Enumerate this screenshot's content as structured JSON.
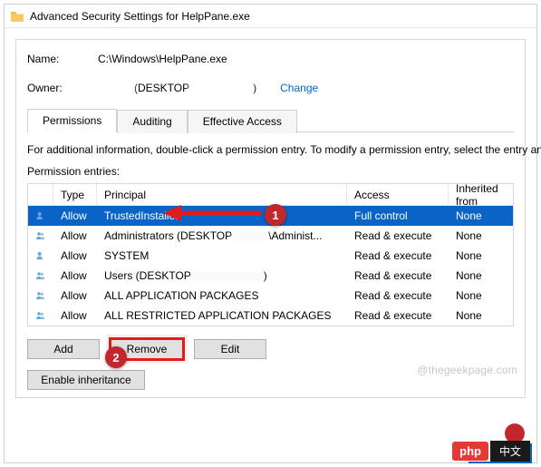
{
  "window": {
    "title": "Advanced Security Settings for HelpPane.exe"
  },
  "header": {
    "name_label": "Name:",
    "name_value": "C:\\Windows\\HelpPane.exe",
    "owner_label": "Owner:",
    "owner_value": "(DESKTOP",
    "change_link": "Change"
  },
  "tabs": {
    "permissions": "Permissions",
    "auditing": "Auditing",
    "effective": "Effective Access"
  },
  "captions": {
    "info": "For additional information, double-click a permission entry. To modify a permission entry, select the entry and",
    "entries": "Permission entries:"
  },
  "columns": {
    "type": "Type",
    "principal": "Principal",
    "access": "Access",
    "inherited": "Inherited from"
  },
  "rows": [
    {
      "type": "Allow",
      "principal": "TrustedInstaller",
      "access": "Full control",
      "inherited": "None",
      "selected": true,
      "icon": "person"
    },
    {
      "type": "Allow",
      "principal": "Administrators (DESKTOP",
      "principal_suffix": "\\Administ...",
      "access": "Read & execute",
      "inherited": "None",
      "icon": "group"
    },
    {
      "type": "Allow",
      "principal": "SYSTEM",
      "access": "Read & execute",
      "inherited": "None",
      "icon": "person"
    },
    {
      "type": "Allow",
      "principal": "Users (DESKTOP",
      "principal_suffix": ")",
      "access": "Read & execute",
      "inherited": "None",
      "icon": "group"
    },
    {
      "type": "Allow",
      "principal": "ALL APPLICATION PACKAGES",
      "access": "Read & execute",
      "inherited": "None",
      "icon": "group"
    },
    {
      "type": "Allow",
      "principal": "ALL RESTRICTED APPLICATION PACKAGES",
      "access": "Read & execute",
      "inherited": "None",
      "icon": "group"
    }
  ],
  "buttons": {
    "add": "Add",
    "remove": "Remove",
    "edit": "Edit",
    "enable": "Enable inheritance"
  },
  "annotations": {
    "one": "1",
    "two": "2"
  },
  "watermark": "@thegeekpage.com",
  "badge": {
    "php": "php",
    "cn": "中文"
  }
}
